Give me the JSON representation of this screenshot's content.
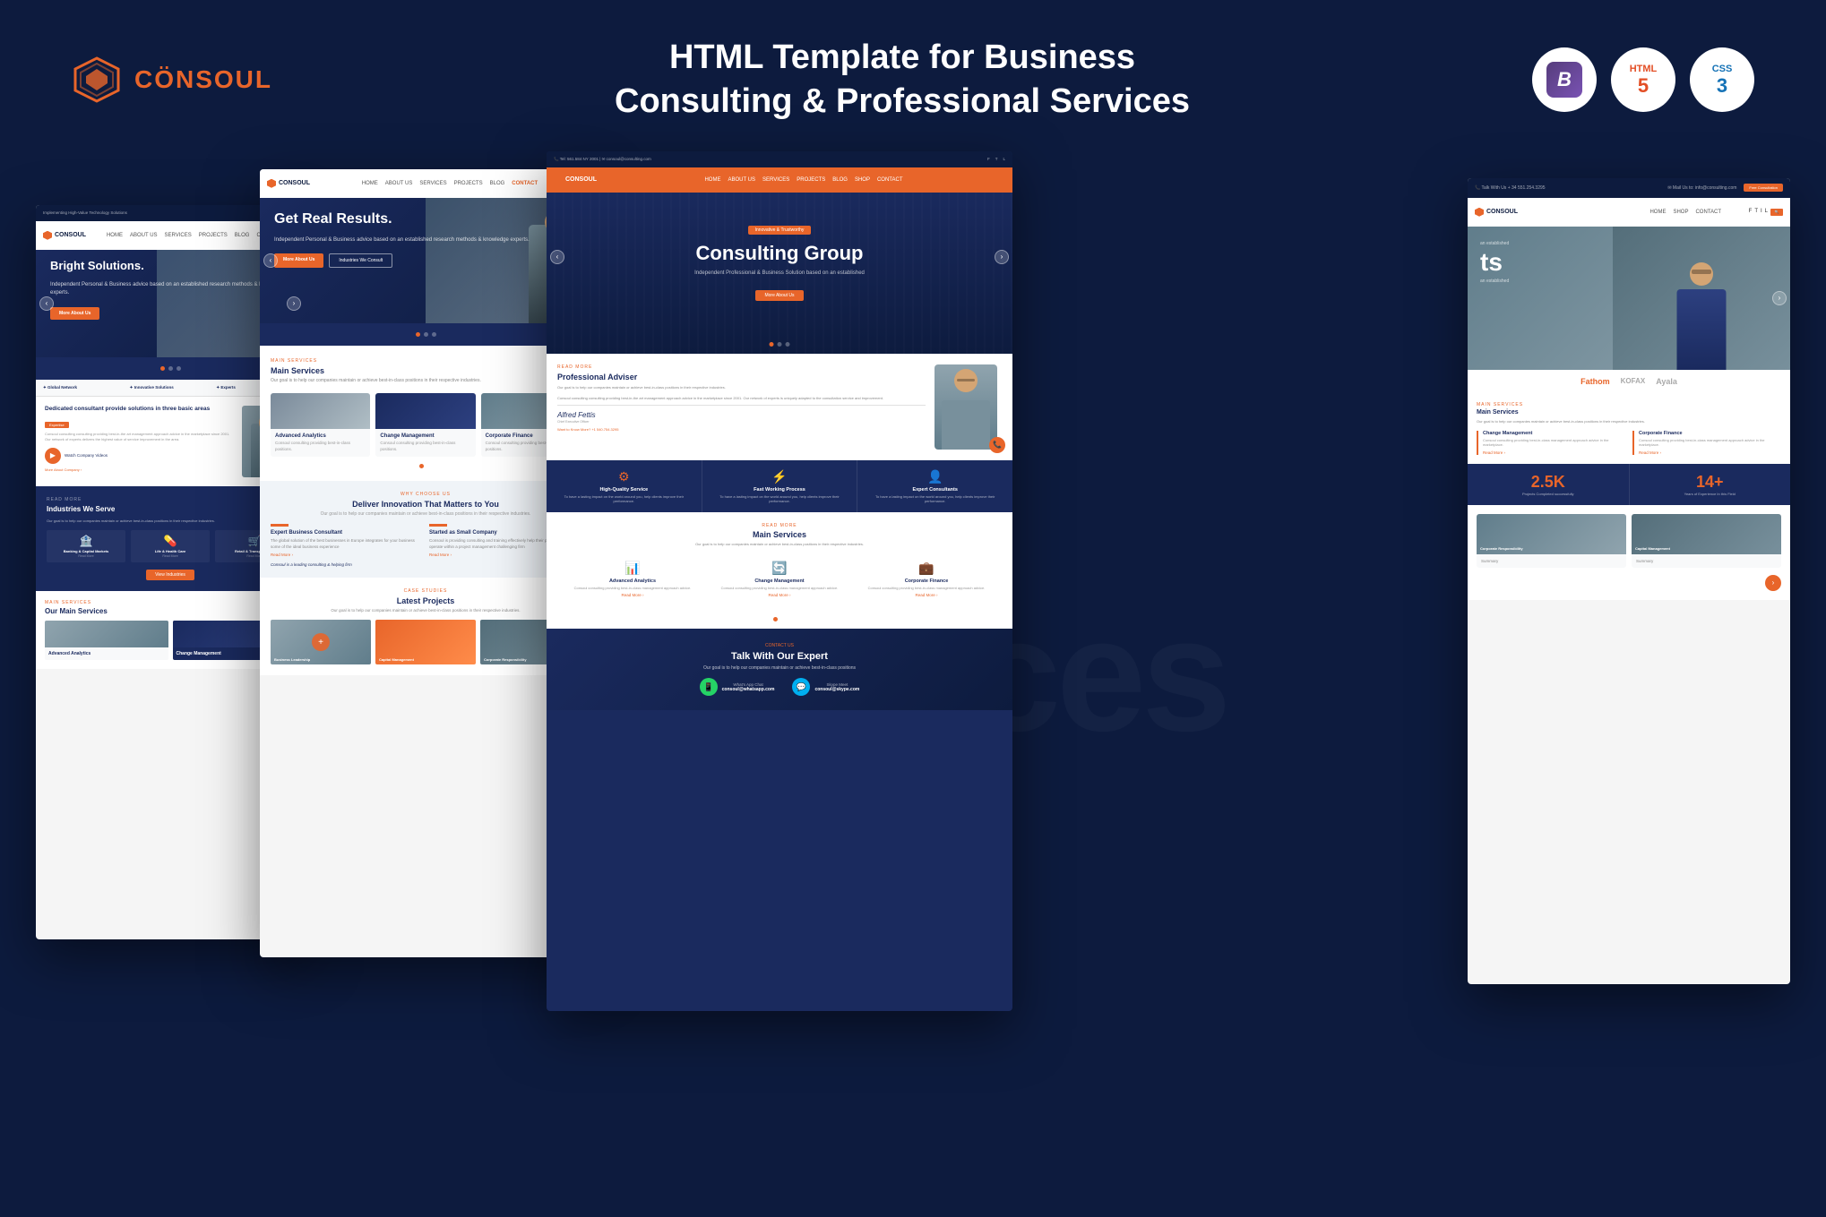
{
  "header": {
    "logo": {
      "brand": "CÖNSOUL"
    },
    "title_line1": "HTML Template for Business",
    "title_line2": "Consulting & Professional Services",
    "badges": [
      {
        "name": "Bootstrap",
        "symbol": "B",
        "color": "#7952b3"
      },
      {
        "name": "HTML5",
        "symbol": "5"
      },
      {
        "name": "CSS3",
        "symbol": "3"
      }
    ]
  },
  "screenshots": {
    "far_left": {
      "hero_title": "Bright Solutions.",
      "hero_sub": "Independent Personal & Business advice based on an established research methods & knowledge experts.",
      "btn1": "More About Us",
      "industries_title": "Industries We Serve",
      "industry1": "Banking & Capital Markets",
      "industry2": "Life & Health Care",
      "industry3": "Retail & Transportation",
      "main_services_label": "MAIN SERVICES",
      "main_services_title": "Our Main Services"
    },
    "mid_left": {
      "hero_title": "Get Real Results.",
      "hero_sub": "Independent Personal & Business advice based on an established research methods & knowledge experts.",
      "btn1": "More About Us",
      "btn2": "Industries We Consult",
      "main_services_label": "MAIN SERVICES",
      "main_services_title": "Main Services",
      "services": [
        "Advanced Analytics",
        "Change Management",
        "Corporate Finance"
      ],
      "why_label": "WHY CHOOSE US",
      "why_title": "Deliver Innovation That Matters to You",
      "why_sub": "Our goal is to help our companies maintain or achieve best-in-class positions in their respective industries.",
      "why_col1_title": "Expert Business Consultant",
      "why_col2_title": "Started as Small Company",
      "projects_label": "CASE STUDIES",
      "projects_title": "Latest Projects",
      "projects": [
        "Business Leadership",
        "Capital Management",
        "Corporate Responsibility"
      ]
    },
    "center": {
      "navbar": [
        "HOME",
        "ABOUT US",
        "SERVICES",
        "PROJECTS",
        "BLOG",
        "CONTACT"
      ],
      "hero_badge": "Innovative & Trustworthy",
      "hero_title": "Consulting Group",
      "hero_sub": "Independent Professional & Business Solution based on an established",
      "hero_btn": "More About Us",
      "adviser_label": "READ MORE",
      "adviser_title": "Professional Adviser",
      "adviser_sub": "Our goal is to help our companies maintain or achieve best-in-class positions in their respective industries.",
      "adviser_sign": "Alfred Fettis",
      "adviser_contact": "Want to Know More? +1 540.754.3295",
      "features": [
        {
          "title": "High-Quality Service",
          "icon": "⚙"
        },
        {
          "title": "Fast Working Process",
          "icon": "⚡"
        },
        {
          "title": "Expert Consultants",
          "icon": "👤"
        }
      ],
      "services_label": "READ MORE",
      "services_title": "Main Services",
      "services": [
        {
          "title": "Advanced Analytics",
          "icon": "📊"
        },
        {
          "title": "Change Management",
          "icon": "🔄"
        },
        {
          "title": "Corporate Finance",
          "icon": "💼"
        }
      ],
      "cta_title": "Talk With Our Expert",
      "cta_whatsapp": "What's App Chat",
      "cta_skype": "Skype Meet"
    },
    "far_right": {
      "top_bar_left": "Talk With Us + 34 551.254.3295",
      "top_bar_right": "Mail Us to: info@consulting.com",
      "nav_items": [
        "HOME",
        "SHOP",
        "CONTACT"
      ],
      "nav_consult": "Free Consultation",
      "hero_title": "ts",
      "hero_sub": "an established",
      "logos": [
        "Fathom",
        "KOFAX",
        "Ayala"
      ],
      "services_label": "MAIN SERVICES",
      "services": [
        "Change Management",
        "Corporate Finance"
      ],
      "stats": [
        {
          "num": "2.5K",
          "label": "Projects Completed successfully"
        },
        {
          "num": "14+",
          "label": "Years of Experience In this Field"
        }
      ],
      "industries": [
        "Corporate Responsibility",
        "Capital Management"
      ]
    }
  }
}
